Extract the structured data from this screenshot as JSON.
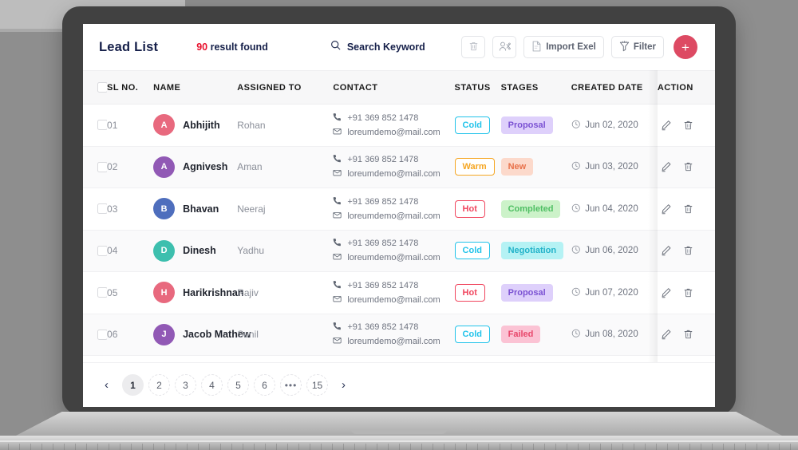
{
  "header": {
    "title": "Lead List",
    "result_count": "90",
    "result_label": " result found",
    "search_placeholder": "Search Keyword",
    "search_value": ""
  },
  "toolbar": {
    "delete_label": "",
    "assign_label": "",
    "import_label": "Import Exel",
    "filter_label": "Filter",
    "add_label": "+",
    "add_color": "#dd4a63"
  },
  "table": {
    "columns": [
      "SL NO.",
      "NAME",
      "ASSIGNED TO",
      "CONTACT",
      "STATUS",
      "STAGES",
      "CREATED DATE",
      "ACTION"
    ],
    "rows": [
      {
        "sl": "01",
        "initial": "A",
        "avatar_color": "#e8697e",
        "name": "Abhijith",
        "assigned": "Rohan",
        "phone": "+91 369 852 1478",
        "email": "loreumdemo@mail.com",
        "status": "Cold",
        "status_style": "outline",
        "status_color": "#22c3ea",
        "status_bg": "#ffffff",
        "stage": "Proposal",
        "stage_style": "fill",
        "stage_color": "#7b52d3",
        "stage_bg": "#ded0fb",
        "date": "Jun 02, 2020"
      },
      {
        "sl": "02",
        "initial": "A",
        "avatar_color": "#9159b5",
        "name": "Agnivesh",
        "assigned": "Aman",
        "phone": "+91 369 852 1478",
        "email": "loreumdemo@mail.com",
        "status": "Warm",
        "status_style": "outline",
        "status_color": "#f5a623",
        "status_bg": "#ffffff",
        "stage": "New",
        "stage_style": "fill",
        "stage_color": "#e8714a",
        "stage_bg": "#fcd9cb",
        "date": "Jun 03, 2020"
      },
      {
        "sl": "03",
        "initial": "B",
        "avatar_color": "#4e6ebd",
        "name": "Bhavan",
        "assigned": "Neeraj",
        "phone": "+91 369 852 1478",
        "email": "loreumdemo@mail.com",
        "status": "Hot",
        "status_style": "outline",
        "status_color": "#f0465e",
        "status_bg": "#ffffff",
        "stage": "Completed",
        "stage_style": "fill",
        "stage_color": "#4fbf63",
        "stage_bg": "#ccf2c9",
        "date": "Jun 04, 2020"
      },
      {
        "sl": "04",
        "initial": "D",
        "avatar_color": "#3dbfae",
        "name": "Dinesh",
        "assigned": "Yadhu",
        "phone": "+91 369 852 1478",
        "email": "loreumdemo@mail.com",
        "status": "Cold",
        "status_style": "outline",
        "status_color": "#22c3ea",
        "status_bg": "#ffffff",
        "stage": "Negotiation",
        "stage_style": "fill",
        "stage_color": "#22b3c9",
        "stage_bg": "#b5f2f4",
        "date": "Jun 06, 2020"
      },
      {
        "sl": "05",
        "initial": "H",
        "avatar_color": "#e8697e",
        "name": "Harikrishnan",
        "assigned": "Rajiv",
        "phone": "+91 369 852 1478",
        "email": "loreumdemo@mail.com",
        "status": "Hot",
        "status_style": "outline",
        "status_color": "#f0465e",
        "status_bg": "#ffffff",
        "stage": "Proposal",
        "stage_style": "fill",
        "stage_color": "#7b52d3",
        "stage_bg": "#ded0fb",
        "date": "Jun 07, 2020"
      },
      {
        "sl": "06",
        "initial": "J",
        "avatar_color": "#9159b5",
        "name": "Jacob Mathew",
        "assigned": "Sunil",
        "phone": "+91 369 852 1478",
        "email": "loreumdemo@mail.com",
        "status": "Cold",
        "status_style": "outline",
        "status_color": "#22c3ea",
        "status_bg": "#ffffff",
        "stage": "Failed",
        "stage_style": "fill",
        "stage_color": "#e8476b",
        "stage_bg": "#fbc3d4",
        "date": "Jun 08, 2020"
      }
    ]
  },
  "pagination": {
    "prev": "‹",
    "next": "›",
    "pages": [
      "1",
      "2",
      "3",
      "4",
      "5",
      "6",
      "•••",
      "15"
    ],
    "active": "1"
  }
}
